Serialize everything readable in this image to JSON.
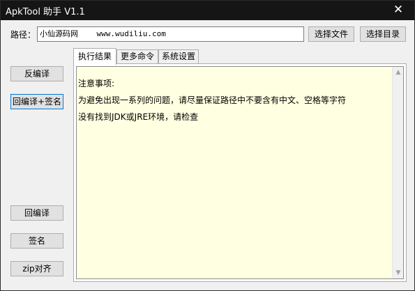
{
  "window": {
    "title": "ApkTool 助手 V1.1",
    "close_glyph": "✕"
  },
  "path": {
    "label": "路径：",
    "value": "小仙源码网    www.wudiliu.com",
    "browse_file_label": "选择文件",
    "browse_dir_label": "选择目录"
  },
  "actions": {
    "decompile": "反编译",
    "recompile_sign": "回编译+签名",
    "recompile": "回编译",
    "sign": "签名",
    "zipalign": "zip对齐"
  },
  "tabs": [
    "执行结果",
    "更多命令",
    "系统设置"
  ],
  "output": {
    "lines": [
      "注意事项:",
      "为避免出现一系列的问题，请尽量保证路径中不要含有中文、空格等字符",
      "没有找到JDK或JRE环境，请检查"
    ]
  },
  "scrollbar": {
    "up_glyph": "▲",
    "down_glyph": "▼"
  }
}
